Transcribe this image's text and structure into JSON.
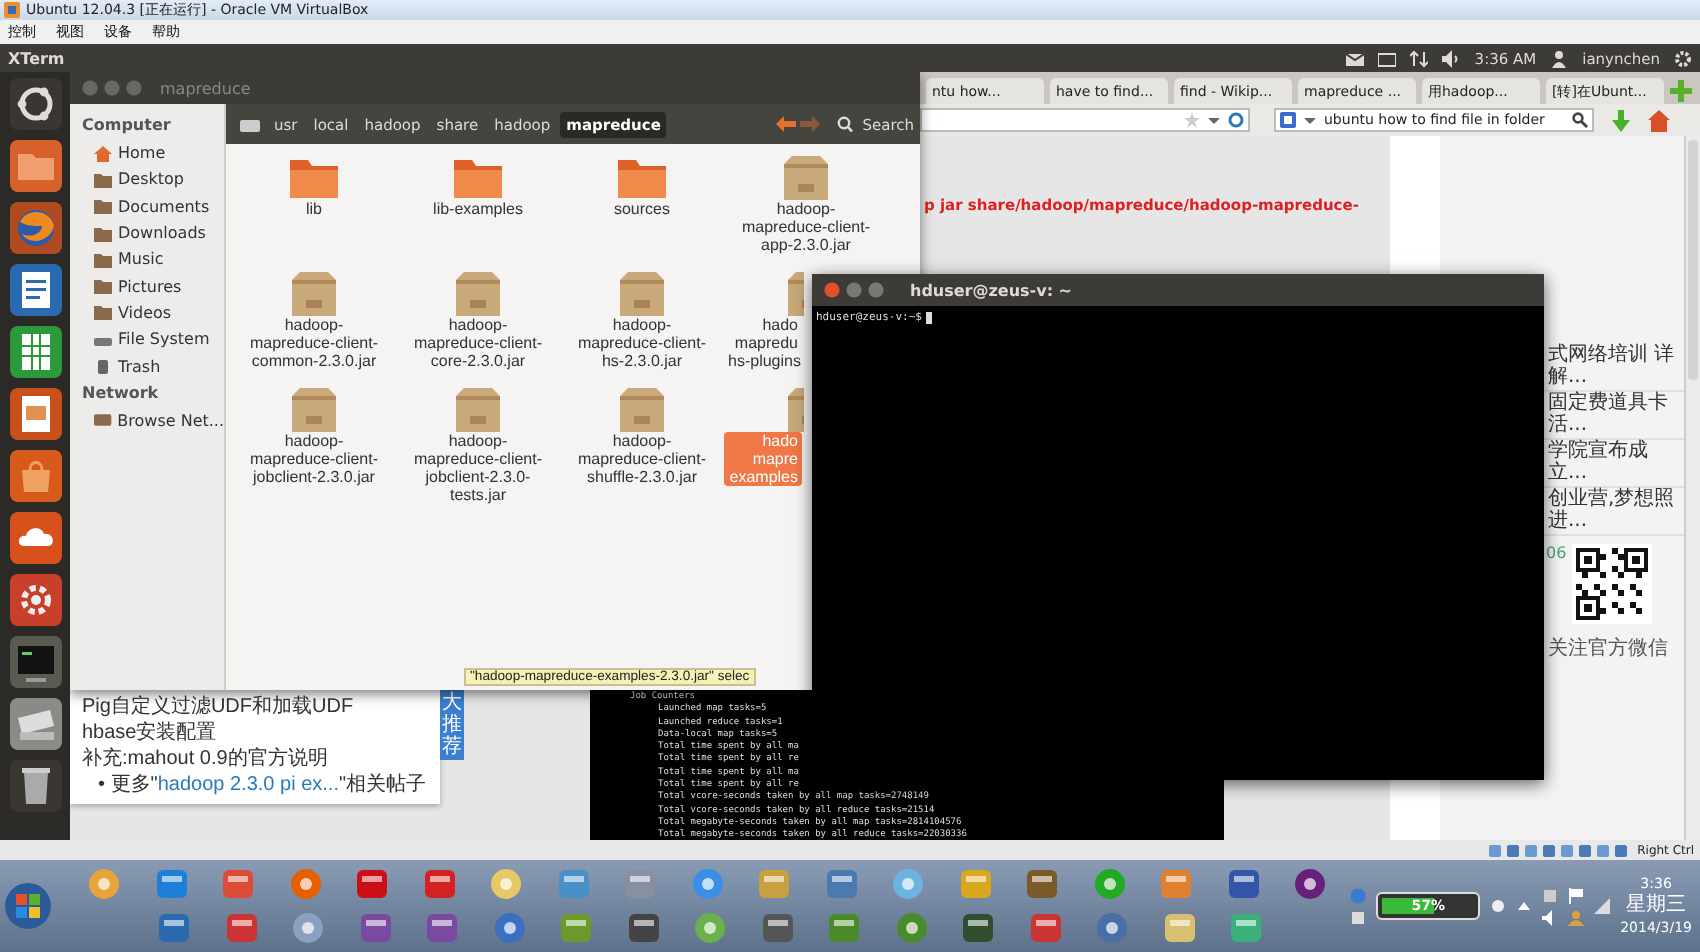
{
  "host_window": {
    "title": "Ubuntu 12.04.3 [正在运行] - Oracle VM VirtualBox",
    "menu": [
      "控制",
      "视图",
      "设备",
      "帮助"
    ]
  },
  "top_panel": {
    "app_name": "XTerm",
    "time": "3:36 AM",
    "user": "ianynchen"
  },
  "browser": {
    "tabs": [
      "ntu how...",
      "have to find...",
      "find - Wikip...",
      "mapreduce ...",
      "用hadoop...",
      "[转]在Ubunt..."
    ],
    "search": {
      "value": "ubuntu how to find file in folder"
    },
    "page": {
      "command_text": "p jar share/hadoop/mapreduce/hadoop-mapreduce-",
      "recommendations": [
        "Pig自定义过滤UDF和加载UDF",
        "hbase安装配置",
        "补充:mahout 0.9的官方说明"
      ],
      "more": {
        "prefix": "• 更多\"",
        "link": "hadoop 2.3.0 pi ex...",
        "suffix": "\"相关帖子"
      },
      "recommend_tab": "大推荐",
      "console_lines": [
        {
          "text": "Job Counters",
          "kind": "heading"
        },
        {
          "text": "Launched map tasks=5",
          "kind": "entry"
        },
        {
          "text": "Launched reduce tasks=1",
          "kind": "entry"
        },
        {
          "text": "Data-local map tasks=5",
          "kind": "entry"
        },
        {
          "text": "Total time spent by all ma",
          "kind": "entry"
        },
        {
          "text": "Total time spent by all re",
          "kind": "entry"
        },
        {
          "text": "Total time spent by all ma",
          "kind": "entry"
        },
        {
          "text": "Total time spent by all re",
          "kind": "entry"
        },
        {
          "text": "Total vcore-seconds taken by all map tasks=2748149",
          "kind": "entry"
        },
        {
          "text": "Total vcore-seconds taken by all reduce tasks=21514",
          "kind": "entry"
        },
        {
          "text": "Total megabyte-seconds taken by all map tasks=2814104576",
          "kind": "entry"
        },
        {
          "text": "Total megabyte-seconds taken by all reduce tasks=22030336",
          "kind": "entry"
        }
      ],
      "side_links": [
        "式网络培训 详解...",
        "固定费道具卡活...",
        "学院宣布成立...",
        "创业营,梦想照进..."
      ],
      "number": "06",
      "qr_caption": "关注官方微信"
    }
  },
  "file_manager": {
    "title": "mapreduce",
    "sidebar": [
      {
        "heading": "Computer",
        "items": [
          {
            "label": "Home",
            "kind": "home"
          },
          {
            "label": "Desktop",
            "kind": "folder"
          },
          {
            "label": "Documents",
            "kind": "folder"
          },
          {
            "label": "Downloads",
            "kind": "folder"
          },
          {
            "label": "Music",
            "kind": "folder"
          },
          {
            "label": "Pictures",
            "kind": "folder"
          },
          {
            "label": "Videos",
            "kind": "folder"
          },
          {
            "label": "File System",
            "kind": "drive"
          },
          {
            "label": "Trash",
            "kind": "trash"
          }
        ]
      },
      {
        "heading": "Network",
        "items": [
          {
            "label": "Browse Net...",
            "kind": "network"
          }
        ]
      }
    ],
    "path": [
      {
        "label": "usr",
        "selected": false
      },
      {
        "label": "local",
        "selected": false
      },
      {
        "label": "hadoop",
        "selected": false
      },
      {
        "label": "share",
        "selected": false
      },
      {
        "label": "hadoop",
        "selected": false
      },
      {
        "label": "mapreduce",
        "selected": true
      }
    ],
    "search_label": "Search",
    "files": [
      {
        "kind": "folder",
        "lines": [
          "lib"
        ],
        "selected": false
      },
      {
        "kind": "folder",
        "lines": [
          "lib-examples"
        ],
        "selected": false
      },
      {
        "kind": "folder",
        "lines": [
          "sources"
        ],
        "selected": false
      },
      {
        "kind": "jar",
        "lines": [
          "hadoop-",
          "mapreduce-client-",
          "app-2.3.0.jar"
        ],
        "selected": false
      },
      {
        "kind": "jar",
        "lines": [
          "hadoop-",
          "mapreduce-client-",
          "common-2.3.0.jar"
        ],
        "selected": false
      },
      {
        "kind": "jar",
        "lines": [
          "hadoop-",
          "mapreduce-client-",
          "core-2.3.0.jar"
        ],
        "selected": false
      },
      {
        "kind": "jar",
        "lines": [
          "hadoop-",
          "mapreduce-client-",
          "hs-2.3.0.jar"
        ],
        "selected": false
      },
      {
        "kind": "jar",
        "lines": [
          "hado",
          "mapredu",
          "hs-plugins"
        ],
        "selected": false
      },
      {
        "kind": "jar",
        "lines": [
          "hadoop-",
          "mapreduce-client-",
          "jobclient-2.3.0.jar"
        ],
        "selected": false
      },
      {
        "kind": "jar",
        "lines": [
          "hadoop-",
          "mapreduce-client-",
          "jobclient-2.3.0-",
          "tests.jar"
        ],
        "selected": false
      },
      {
        "kind": "jar",
        "lines": [
          "hadoop-",
          "mapreduce-client-",
          "shuffle-2.3.0.jar"
        ],
        "selected": false
      },
      {
        "kind": "jar",
        "lines": [
          "hado",
          "mapre",
          "examples"
        ],
        "selected": true
      }
    ],
    "status": "\"hadoop-mapreduce-examples-2.3.0.jar\" selec"
  },
  "terminal": {
    "title": "hduser@zeus-v: ~",
    "prompt": "hduser@zeus-v:~$"
  },
  "vbox_status": {
    "host_key": "Right Ctrl"
  },
  "taskbar": {
    "battery": {
      "level": 0.57,
      "reading": "57%"
    },
    "time": "3:36",
    "weekday": "星期三",
    "date": "2014/3/19"
  }
}
